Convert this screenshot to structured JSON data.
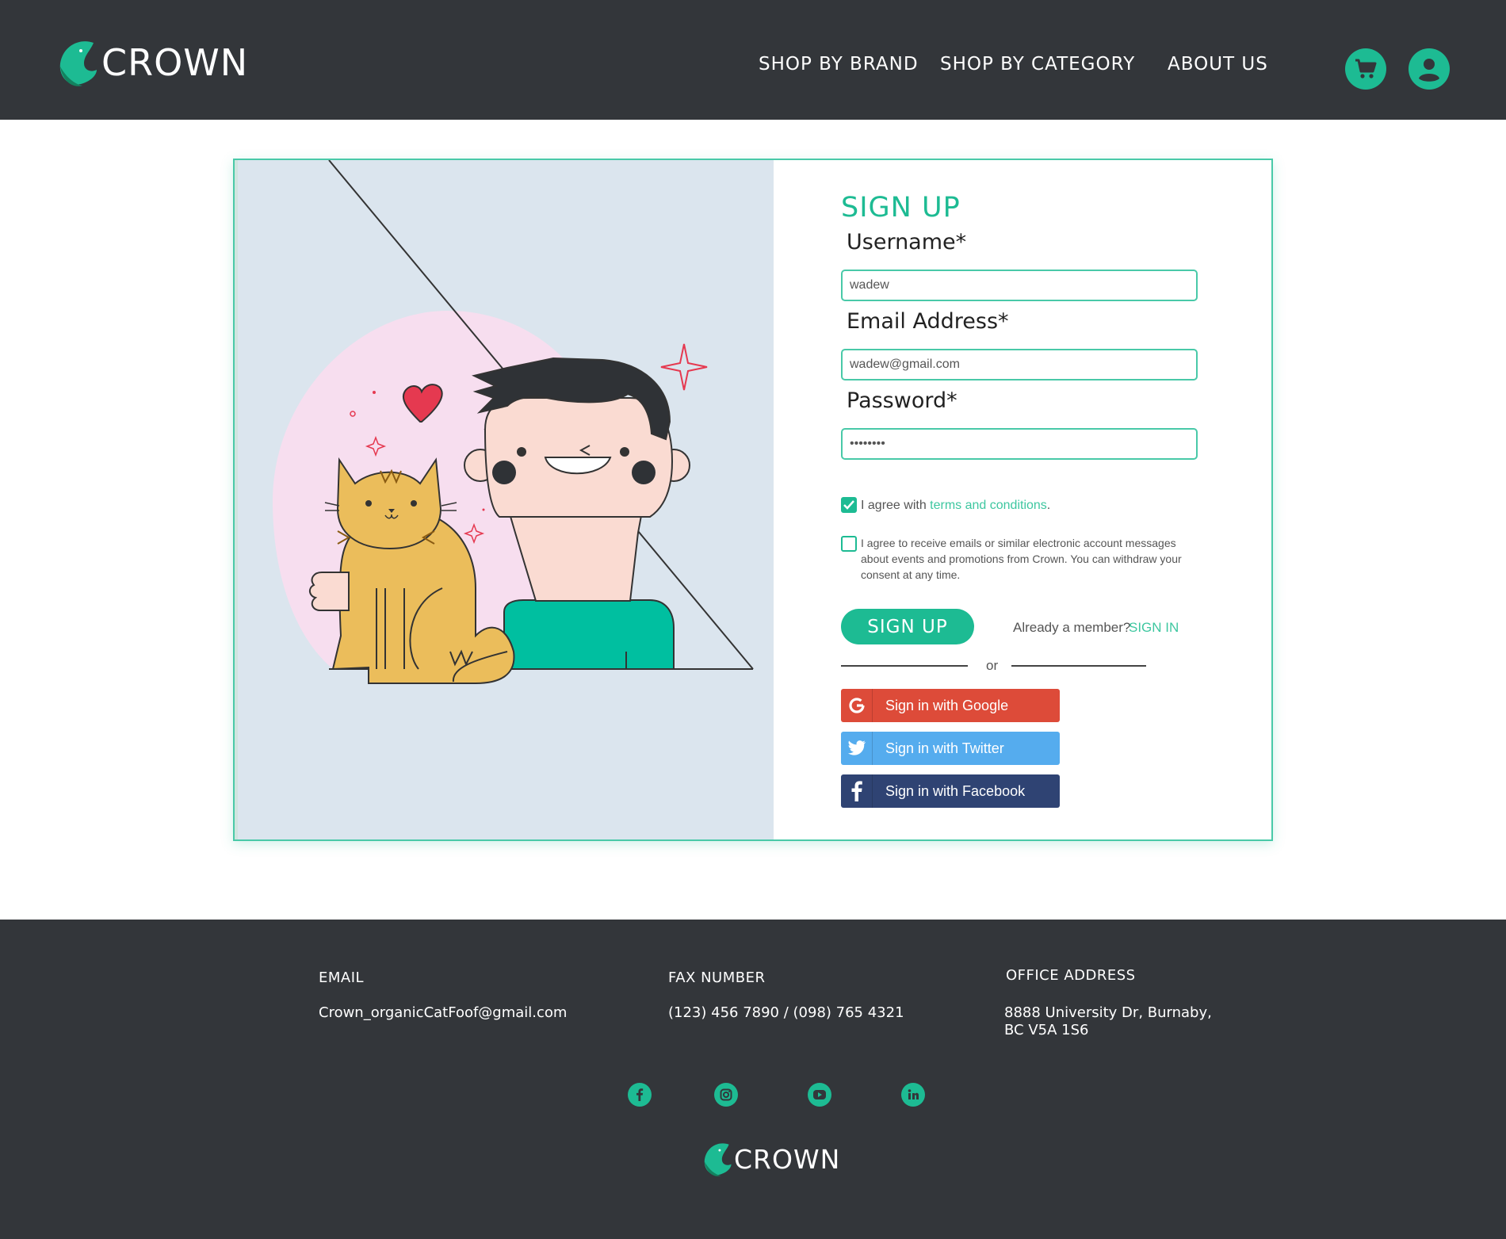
{
  "brand": {
    "name": "CROWN",
    "accent": "#1dbb93",
    "dark_bg": "#33363a"
  },
  "header": {
    "nav": [
      "SHOP BY BRAND",
      "SHOP BY CATEGORY",
      "ABOUT US"
    ],
    "icons": [
      "cart-icon",
      "user-icon"
    ]
  },
  "form": {
    "title": "SIGN UP",
    "username": {
      "label": "Username*",
      "value": "wadew"
    },
    "email": {
      "label": "Email Address*",
      "value": "wadew@gmail.com"
    },
    "password": {
      "label": "Password*",
      "value": "••••••••"
    },
    "agree_terms": {
      "checked": true,
      "prefix": "I agree with ",
      "link": "terms and conditions",
      "suffix": "."
    },
    "agree_emails": {
      "checked": false,
      "text": "I agree to receive emails or similar electronic account messages about events and promotions from Crown. You can withdraw your consent at any time."
    },
    "submit_label": "SIGN UP",
    "member_text": "Already a member?",
    "signin_label": "SIGN IN",
    "or_text": "or",
    "google_label": "Sign in with Google",
    "twitter_label": "Sign in with Twitter",
    "facebook_label": "Sign in with Facebook",
    "google_color": "#dd4b39",
    "twitter_color": "#55acee",
    "facebook_color": "#2f4373"
  },
  "footer": {
    "email_head": "EMAIL",
    "email_value": "Crown_organicCatFoof@gmail.com",
    "fax_head": "FAX NUMBER",
    "fax_value": "(123) 456 7890 / (098) 765 4321",
    "address_head": "OFFICE ADDRESS",
    "address_line1": "8888 University Dr, Burnaby,",
    "address_line2": "BC V5A 1S6",
    "social_icons": [
      "facebook-icon",
      "instagram-icon",
      "youtube-icon",
      "linkedin-icon"
    ]
  }
}
